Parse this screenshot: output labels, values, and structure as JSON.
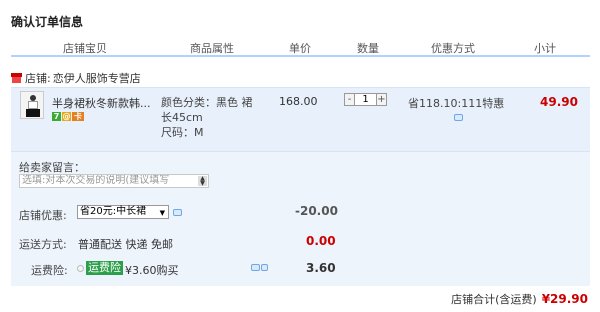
{
  "page": {
    "title": "确认订单信息"
  },
  "columns": [
    "店铺宝贝",
    "商品属性",
    "单价",
    "数量",
    "优惠方式",
    "小计"
  ],
  "shop": {
    "label": "店铺:",
    "name": "恋伊人服饰专营店"
  },
  "item": {
    "title": "半身裙秋冬新款韩...",
    "badges": [
      "7",
      "@",
      "卡"
    ],
    "attr_lines": [
      "颜色分类：黑色 裙",
      "长45cm",
      "尺码：M"
    ],
    "price": "168.00",
    "quantity": "1",
    "qty_minus": "-",
    "qty_plus": "+",
    "promo": "省118.10:111特惠",
    "subtotal": "49.90"
  },
  "message": {
    "label": "给卖家留言：",
    "placeholder": "选填:对本次交易的说明(建议填写"
  },
  "shop_discount": {
    "label": "店铺优惠:",
    "selected": "省20元:中长裙",
    "amount": "-20.00"
  },
  "shipping": {
    "label": "运送方式:",
    "method": "普通配送 快递 免邮",
    "amount": "0.00"
  },
  "insurance": {
    "label": "运费险:",
    "highlight": "运费险",
    "price_text": "¥3.60购买",
    "amount": "3.60"
  },
  "total": {
    "label": "店铺合计(含运费)",
    "value": "¥29.90"
  },
  "colors": {
    "price_red": "#cc0000",
    "header_border": "#b2d1ff",
    "item_bg": "#e8f0fb",
    "insurance_green": "#2d9f4a"
  }
}
